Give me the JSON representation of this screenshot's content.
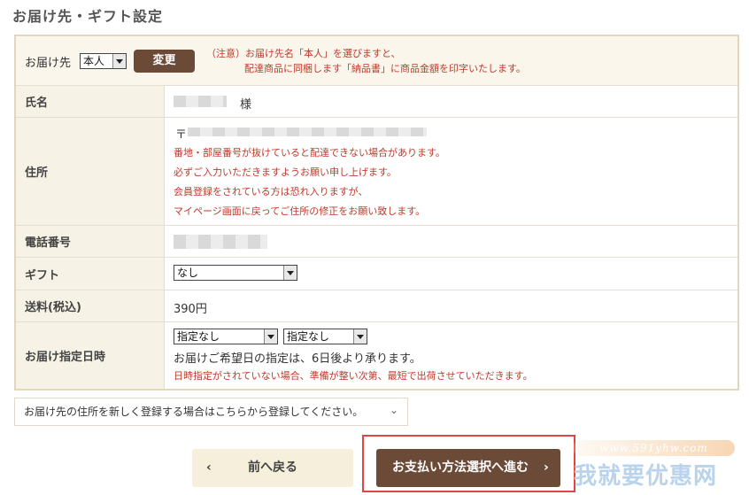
{
  "page_title": "お届け先・ギフト設定",
  "recipient": {
    "label": "お届け先",
    "selected": "本人",
    "change_button": "変更",
    "notice_line1": "（注意）お届け先名「本人」を選びますと、",
    "notice_line2": "配達商品に同梱します「納品書」に商品金額を印字いたします。"
  },
  "name": {
    "label": "氏名",
    "suffix": "様"
  },
  "address": {
    "label": "住所",
    "postal_mark": "〒",
    "notes": [
      "番地・部屋番号が抜けていると配達できない場合があります。",
      "必ずご入力いただきますようお願い申し上げます。",
      "会員登録をされている方は恐れ入りますが、",
      "マイページ画面に戻ってご住所の修正をお願い致します。"
    ]
  },
  "phone": {
    "label": "電話番号"
  },
  "gift": {
    "label": "ギフト",
    "selected": "なし"
  },
  "shipping": {
    "label": "送料(税込)",
    "value": "390円"
  },
  "delivery_date": {
    "label": "お届け指定日時",
    "date_selected": "指定なし",
    "time_selected": "指定なし",
    "info": "お届けご希望日の指定は、6日後より承ります。",
    "note": "日時指定がされていない場合、準備が整い次第、最短で出荷させていただきます。"
  },
  "register_link": "お届け先の住所を新しく登録する場合はこちらから登録してください。",
  "register_chevron": "⌄",
  "back_button": {
    "arrow": "‹",
    "label": "前へ戻る"
  },
  "next_button": {
    "label": "お支払い方法選択へ進む",
    "arrow": "›"
  },
  "watermark": {
    "url": "www.591yhw.com",
    "text": "我就要优惠网"
  },
  "colors": {
    "brand_brown": "#6b4a38",
    "notice_red": "#c0392b",
    "highlight_red": "#e04545"
  }
}
